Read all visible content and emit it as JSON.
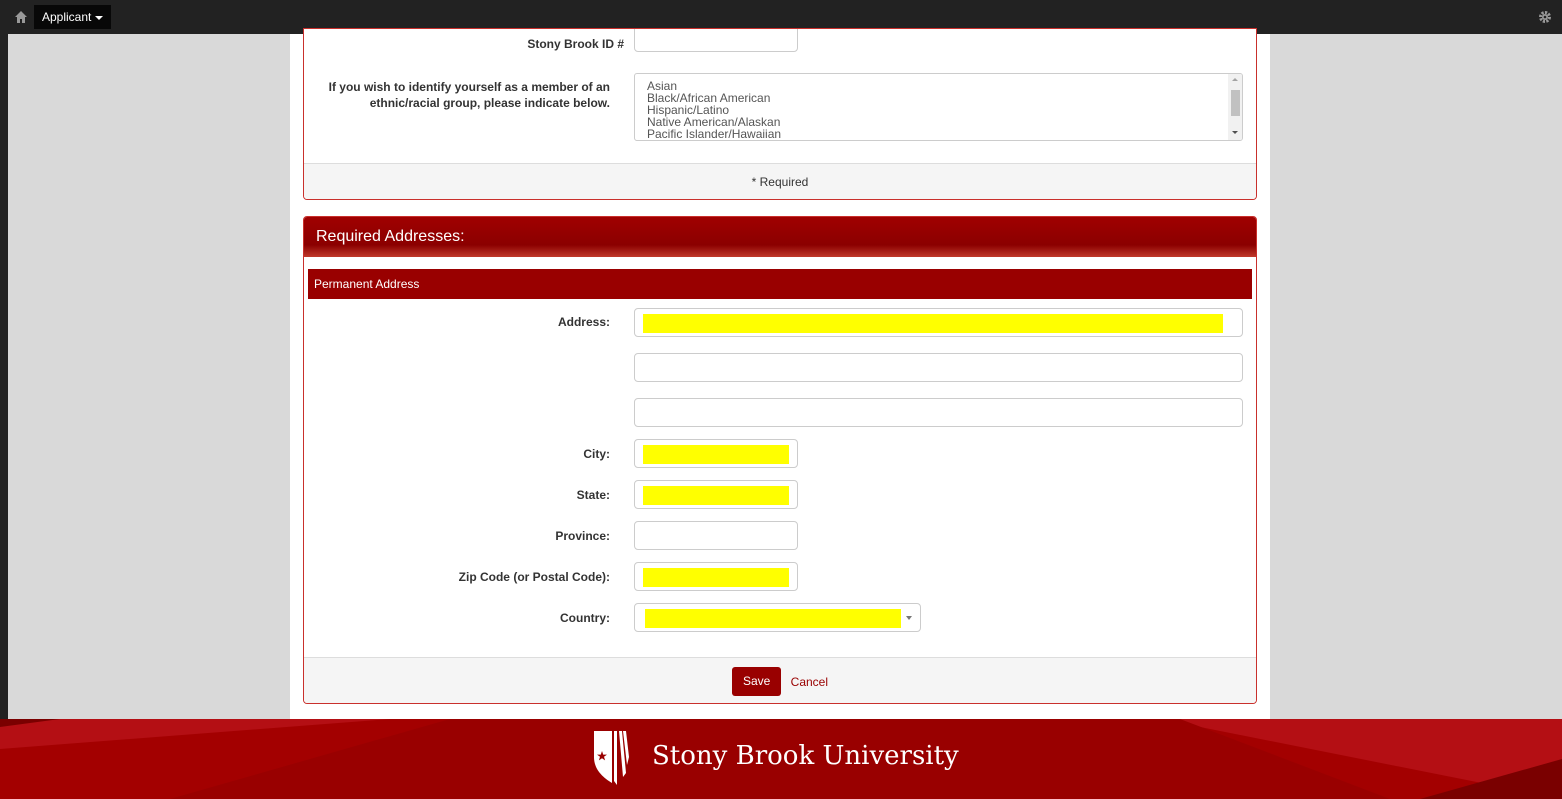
{
  "topbar": {
    "home_icon": "home-icon",
    "menu_label": "Applicant",
    "settings_icon": "gear-icon"
  },
  "demographics": {
    "stony_brook_id_label": "Stony Brook ID #",
    "stony_brook_id_value": "",
    "ethnic_label_line1": "If you wish to identify yourself as a member of an",
    "ethnic_label_line2": "ethnic/racial group, please indicate below.",
    "ethnic_options": [
      "Asian",
      "Black/African American",
      "Hispanic/Latino",
      "Native American/Alaskan",
      "Pacific Islander/Hawaiian"
    ],
    "footer_note": "* Required"
  },
  "addresses": {
    "heading": "Required Addresses:",
    "subheading": "Permanent Address",
    "address_label": "Address:",
    "city_label": "City:",
    "state_label": "State:",
    "province_label": "Province:",
    "zip_label": "Zip Code (or Postal Code):",
    "country_label": "Country:",
    "save_label": "Save",
    "cancel_label": "Cancel",
    "highlight_color": "#ffff00"
  },
  "footer": {
    "brand": "Stony Brook University",
    "accent_color": "#990000"
  }
}
